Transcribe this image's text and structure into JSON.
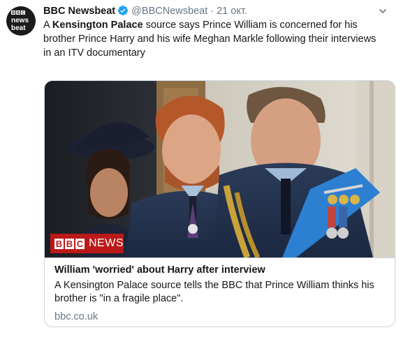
{
  "tweet": {
    "avatar": {
      "logo_lines": [
        "BBC",
        "news",
        "beat"
      ]
    },
    "author_name": "BBC Newsbeat",
    "verified_icon": "verified-badge-icon",
    "handle": "@BBCNewsbeat",
    "separator": "·",
    "timestamp": "21 окт.",
    "menu_icon": "chevron-down-icon",
    "text": {
      "prefix": "A ",
      "bold": "Kensington Palace",
      "suffix": " source says Prince William is concerned for his brother Prince Harry and his wife Meghan Markle following their interviews in an ITV documentary"
    }
  },
  "card": {
    "badge": {
      "boxes": [
        "B",
        "B",
        "C"
      ],
      "label": "NEWS"
    },
    "title": "William 'worried' about Harry after interview",
    "description": "A Kensington Palace source tells the BBC that Prince William thinks his brother is \"in a fragile place\".",
    "domain": "bbc.co.uk"
  },
  "colors": {
    "text": "#14171a",
    "secondary_text": "#657786",
    "verified_blue": "#1da1f2",
    "bbc_red": "#bb1919",
    "border": "#ccd6dd"
  }
}
